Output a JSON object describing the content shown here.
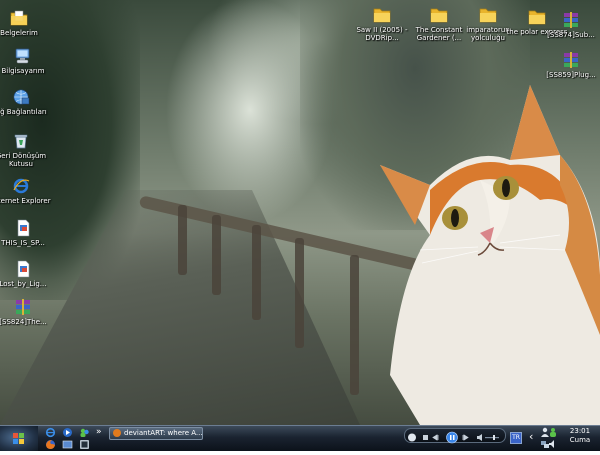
{
  "desktop": {
    "icons": [
      {
        "name": "belgelerim",
        "label": "Belgelerim",
        "icon": "folder-documents-icon"
      },
      {
        "name": "bilgisayarim",
        "label": "Bilgisayarım",
        "icon": "computer-icon"
      },
      {
        "name": "ag-baglantilari",
        "label": "Ağ Bağlantıları",
        "icon": "network-icon"
      },
      {
        "name": "geri-donusum",
        "label": "Geri Dönüşüm Kutusu",
        "icon": "recycle-bin-icon"
      },
      {
        "name": "internet-explorer",
        "label": "Internet Explorer",
        "icon": "ie-icon"
      },
      {
        "name": "file-this",
        "label": "THIS_IS_SP...",
        "icon": "document-icon"
      },
      {
        "name": "file-lost",
        "label": "Lost_by_Lig...",
        "icon": "document-icon"
      },
      {
        "name": "rar-1",
        "label": "[SS824]The...",
        "icon": "rar-archive-icon"
      },
      {
        "name": "saw",
        "label": "Saw II (2005) - DVDRip...",
        "icon": "folder-icon"
      },
      {
        "name": "constant-gardener",
        "label": "The Constant Gardener (...",
        "icon": "folder-icon"
      },
      {
        "name": "imparatorun",
        "label": "imparatorun yolculuğu",
        "icon": "folder-icon"
      },
      {
        "name": "polar-express",
        "label": "the polar express",
        "icon": "folder-icon"
      },
      {
        "name": "rar-2",
        "label": "[SS874]Sub...",
        "icon": "rar-archive-icon"
      },
      {
        "name": "rar-3",
        "label": "[SS859]Plug...",
        "icon": "rar-archive-icon"
      }
    ]
  },
  "taskbar": {
    "start_label": "",
    "quick_launch_more": "»",
    "task_button": "deviantART: where A...",
    "media": {
      "play_icon": "play-icon",
      "stop_icon": "stop-icon",
      "prev_icon": "prev-icon",
      "next_icon": "next-icon"
    },
    "tray": {
      "lang": "TR",
      "chevron": "‹"
    },
    "clock": {
      "time": "23:01",
      "day": "Cuma"
    }
  },
  "colors": {
    "taskbar_top": "#3c4a5a",
    "taskbar_bottom": "#0c121a",
    "cat_orange": "#d97a2e"
  }
}
